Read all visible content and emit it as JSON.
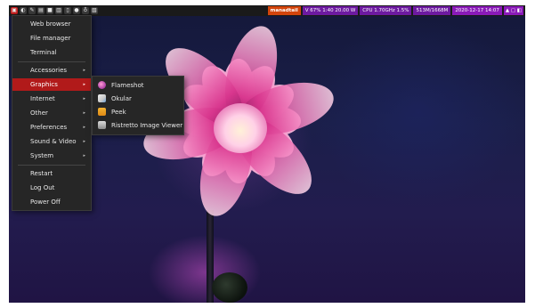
{
  "panel": {
    "launchers": [
      "▣",
      "◐",
      "✎",
      "▤",
      "■",
      "▥",
      "▯",
      "●",
      "♁",
      "▧"
    ],
    "tray": {
      "user": "manadtail",
      "battery": "V 67% 1:40 20.00 W",
      "cpu": "CPU 1.70GHz 1.5%",
      "memory": "513M/1668M",
      "clock": "2020-12-17 14:07",
      "extra": "▲ ▢ ◧"
    }
  },
  "menu": {
    "items": [
      {
        "label": "Web browser",
        "submenu": false
      },
      {
        "label": "File manager",
        "submenu": false
      },
      {
        "label": "Terminal",
        "submenu": false
      },
      {
        "label": "Accessories",
        "submenu": true,
        "arrow": "▸"
      },
      {
        "label": "Graphics",
        "submenu": true,
        "arrow": "▸"
      },
      {
        "label": "Internet",
        "submenu": true,
        "arrow": "▸"
      },
      {
        "label": "Other",
        "submenu": true,
        "arrow": "▸"
      },
      {
        "label": "Preferences",
        "submenu": true,
        "arrow": "▸"
      },
      {
        "label": "Sound & Video",
        "submenu": true,
        "arrow": "▸"
      },
      {
        "label": "System",
        "submenu": true,
        "arrow": "▸"
      },
      {
        "label": "Restart",
        "submenu": false
      },
      {
        "label": "Log Out",
        "submenu": false
      },
      {
        "label": "Power Off",
        "submenu": false
      }
    ],
    "selected": "Graphics"
  },
  "submenu": {
    "items": [
      {
        "label": "Flameshot",
        "icon": "flameshot-icon"
      },
      {
        "label": "Okular",
        "icon": "okular-icon"
      },
      {
        "label": "Peek",
        "icon": "peek-icon"
      },
      {
        "label": "Ristretto Image Viewer",
        "icon": "ristretto-icon"
      }
    ]
  },
  "colors": {
    "panel_bg": "#1a1a1a",
    "menu_bg": "#262626",
    "selected": "#b11a1a",
    "accent_orange": "#d3450c",
    "accent_purple": "#6d1aa0"
  }
}
